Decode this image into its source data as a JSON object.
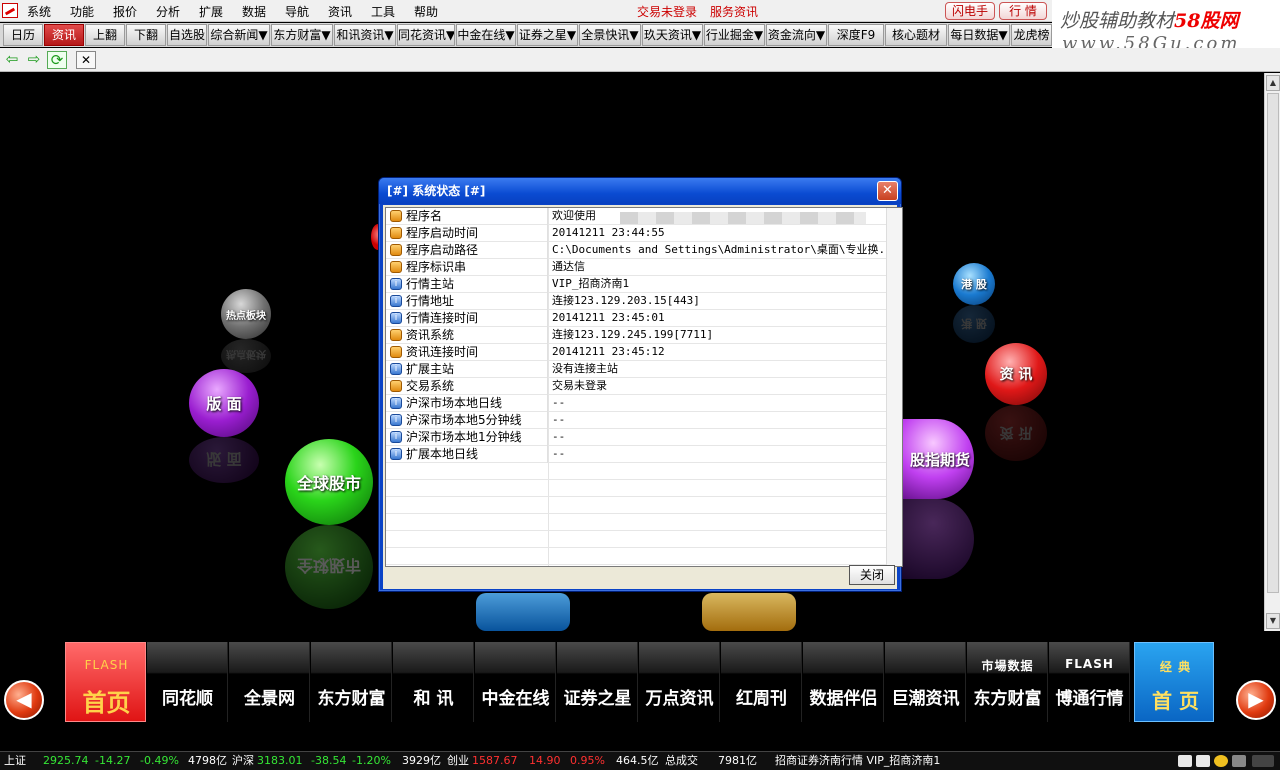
{
  "menu": {
    "items": [
      "系统",
      "功能",
      "报价",
      "分析",
      "扩展",
      "数据",
      "导航",
      "资讯",
      "工具",
      "帮助"
    ],
    "trade_status": "交易未登录",
    "service_info": "服务资讯",
    "flash_btn": "闪电手",
    "quote_btn": "行 情"
  },
  "banner": {
    "line1_prefix": "炒股辅助教材",
    "line1_brand": "58股网",
    "line2": "www.58Gu.com"
  },
  "toolbar": {
    "items": [
      "日历",
      "资讯",
      "上翻",
      "下翻",
      "自选股",
      "综合新闻▼",
      "东方财富▼",
      "和讯资讯▼",
      "同花资讯▼",
      "中金在线▼",
      "证券之星▼",
      "全景快讯▼",
      "玖天资讯▼",
      "行业掘金▼",
      "资金流向▼",
      "深度F9",
      "核心题材",
      "每日数据▼",
      "龙虎榜"
    ]
  },
  "navbar": {
    "back": "⇦",
    "forward": "⇨",
    "refresh": "⟳",
    "close": "✕"
  },
  "balls": {
    "hot": "热点板块",
    "layout": "版 面",
    "market": "全球股市",
    "hk": "港 股",
    "news": "资 讯",
    "futures": "股指期货"
  },
  "colors": {
    "dialog_title": "#0a4bd2",
    "rise": "#ff3030",
    "fall": "#35e635"
  },
  "dialog": {
    "title": "[#] 系统状态 [#]",
    "close_label": "关闭",
    "rows": [
      {
        "key": "程序名",
        "value": "欢迎使用",
        "icon": "o"
      },
      {
        "key": "程序启动时间",
        "value": "20141211 23:44:55",
        "icon": "o"
      },
      {
        "key": "程序启动路径",
        "value": "C:\\Documents and Settings\\Administrator\\桌面\\专业换...",
        "icon": "o"
      },
      {
        "key": "程序标识串",
        "value": "通达信",
        "icon": "o"
      },
      {
        "key": "行情主站",
        "value": "VIP_招商济南1",
        "icon": "b"
      },
      {
        "key": "行情地址",
        "value": "连接123.129.203.15[443]",
        "icon": "b"
      },
      {
        "key": "行情连接时间",
        "value": "20141211 23:45:01",
        "icon": "b"
      },
      {
        "key": "资讯系统",
        "value": "连接123.129.245.199[7711]",
        "icon": "o"
      },
      {
        "key": "资讯连接时间",
        "value": "20141211 23:45:12",
        "icon": "o"
      },
      {
        "key": "扩展主站",
        "value": "没有连接主站",
        "icon": "b"
      },
      {
        "key": "交易系统",
        "value": "交易未登录",
        "icon": "o"
      },
      {
        "key": "沪深市场本地日线",
        "value": "--",
        "icon": "b"
      },
      {
        "key": "沪深市场本地5分钟线",
        "value": "--",
        "icon": "b"
      },
      {
        "key": "沪深市场本地1分钟线",
        "value": "--",
        "icon": "b"
      },
      {
        "key": "扩展本地日线",
        "value": "--",
        "icon": "b"
      }
    ]
  },
  "bottom_nav": {
    "home_sub": "FLASH",
    "home_label": "首页",
    "tiles": [
      "同花顺",
      "全景网",
      "东方财富",
      "和  讯",
      "中金在线",
      "证券之星",
      "万点资讯",
      "红周刊",
      "数据伴侣",
      "巨潮资讯",
      "东方财富",
      "博通行情"
    ],
    "tile_subs": [
      "",
      "",
      "",
      "",
      "",
      "",
      "",
      "",
      "",
      "",
      "市場数据",
      "FLASH"
    ],
    "classic_sub": "经 典",
    "classic_label": "首 页"
  },
  "statusbar": {
    "sh_label": "上证",
    "sh_value": "2925.74",
    "sh_change": "-14.27",
    "sh_pct": "-0.49%",
    "sh_amount": "4798亿",
    "sz_label": "沪深",
    "sz_value": "3183.01",
    "sz_change": "-38.54",
    "sz_pct": "-1.20%",
    "sz_amount": "3929亿",
    "cy_label": "创业",
    "cy_value": "1587.67",
    "cy_change": "14.90",
    "cy_pct": "0.95%",
    "cy_amount": "464.5亿",
    "total_label": "总成交",
    "total_amount": "7981亿",
    "broker": "招商证券济南行情 VIP_招商济南1"
  }
}
